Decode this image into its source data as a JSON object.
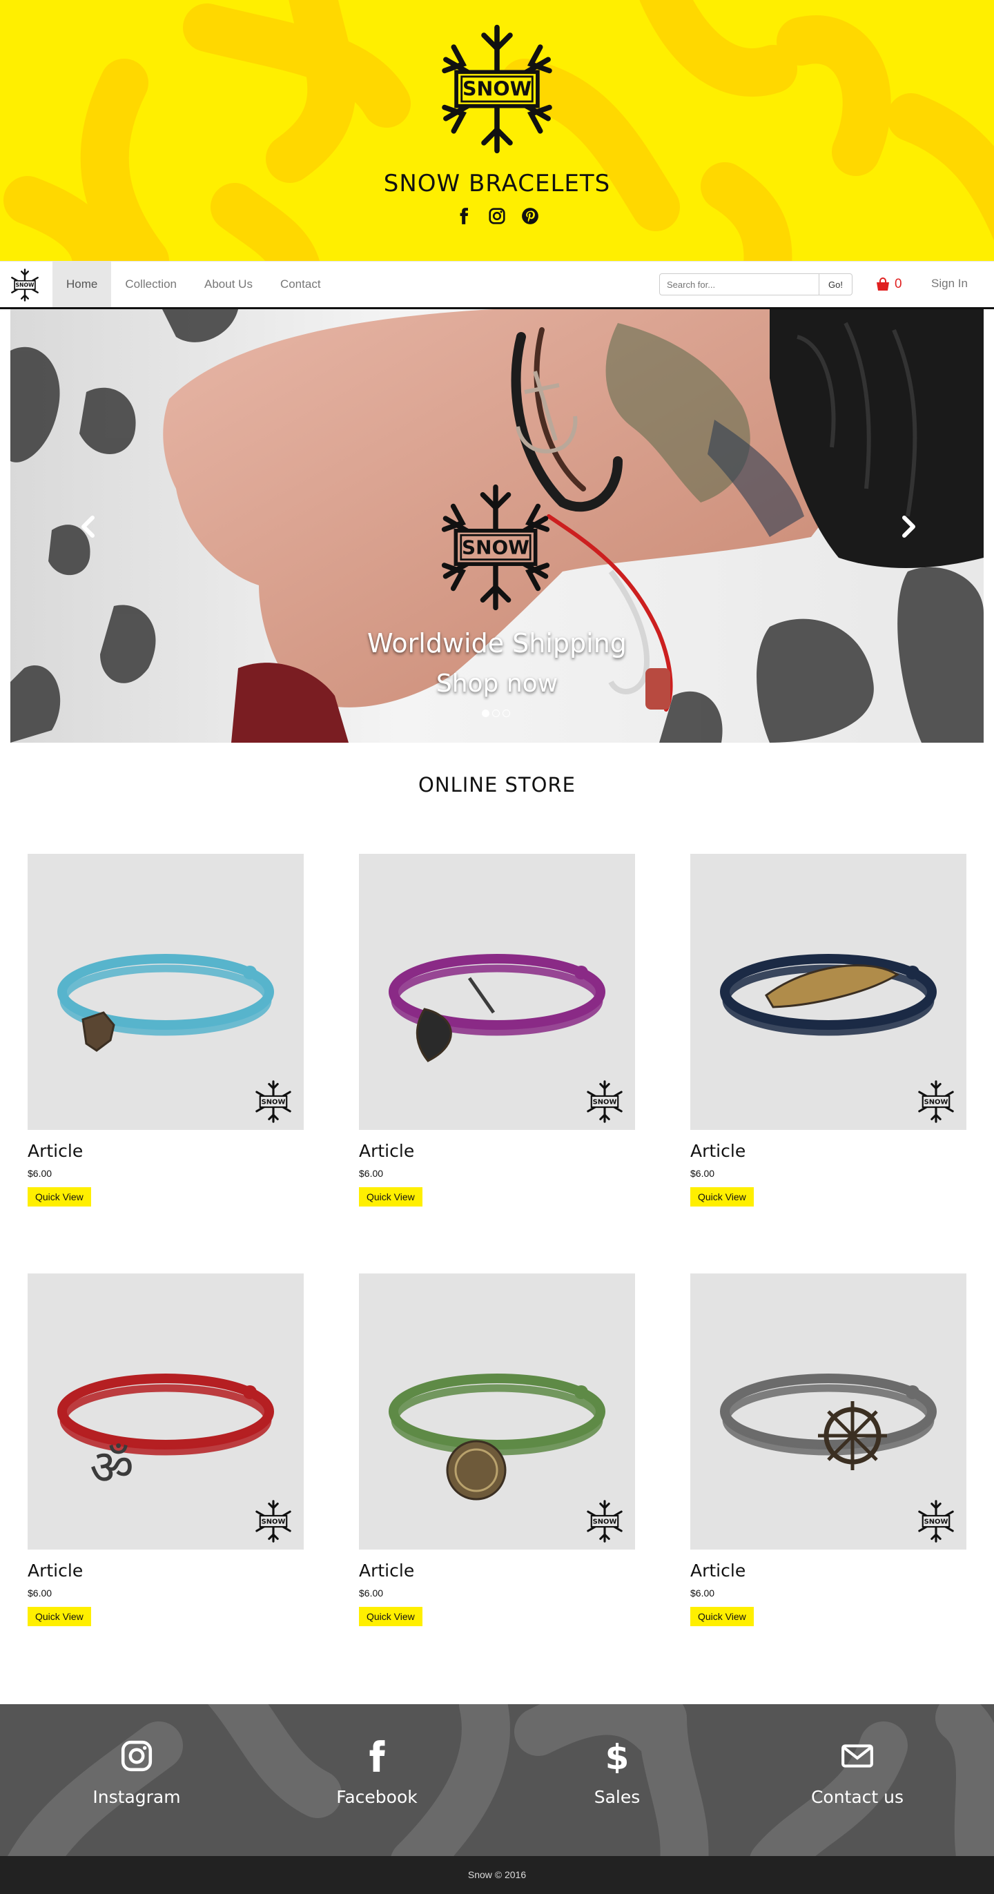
{
  "header": {
    "brand_title": "SNOW BRACELETS",
    "logo_text": "SNOW",
    "social_icons": [
      "facebook-icon",
      "instagram-icon",
      "pinterest-icon"
    ],
    "background_color": "#ffef00"
  },
  "navbar": {
    "logo_text": "SNOW",
    "items": [
      {
        "label": "Home",
        "active": true
      },
      {
        "label": "Collection",
        "active": false
      },
      {
        "label": "About Us",
        "active": false
      },
      {
        "label": "Contact",
        "active": false
      }
    ],
    "search": {
      "placeholder": "Search for...",
      "button_label": "Go!"
    },
    "cart": {
      "count": "0",
      "icon": "shopping-bag-icon",
      "color": "#e02020"
    },
    "signin_label": "Sign In"
  },
  "carousel": {
    "logo_text": "SNOW",
    "caption_line1": "Worldwide Shipping",
    "caption_line2": "Shop now",
    "slide_count": 3,
    "active_slide": 1
  },
  "store": {
    "title": "ONLINE STORE",
    "products": [
      {
        "name": "Article",
        "price": "$6.00",
        "button": "Quick View",
        "cord_color": "#57b4cc",
        "charm": "map"
      },
      {
        "name": "Article",
        "price": "$6.00",
        "button": "Quick View",
        "cord_color": "#8a2a86",
        "charm": "leaf"
      },
      {
        "name": "Article",
        "price": "$6.00",
        "button": "Quick View",
        "cord_color": "#1b2a45",
        "charm": "wing"
      },
      {
        "name": "Article",
        "price": "$6.00",
        "button": "Quick View",
        "cord_color": "#b51f22",
        "charm": "om"
      },
      {
        "name": "Article",
        "price": "$6.00",
        "button": "Quick View",
        "cord_color": "#5e8a46",
        "charm": "cap"
      },
      {
        "name": "Article",
        "price": "$6.00",
        "button": "Quick View",
        "cord_color": "#6b6b6b",
        "charm": "helm"
      }
    ],
    "watermark_text": "SNOW",
    "button_color": "#ffef00"
  },
  "footer": {
    "items": [
      {
        "label": "Instagram",
        "icon": "instagram-icon"
      },
      {
        "label": "Facebook",
        "icon": "facebook-icon"
      },
      {
        "label": "Sales",
        "icon": "dollar-icon"
      },
      {
        "label": "Contact us",
        "icon": "envelope-icon"
      }
    ],
    "copyright": "Snow © 2016"
  }
}
